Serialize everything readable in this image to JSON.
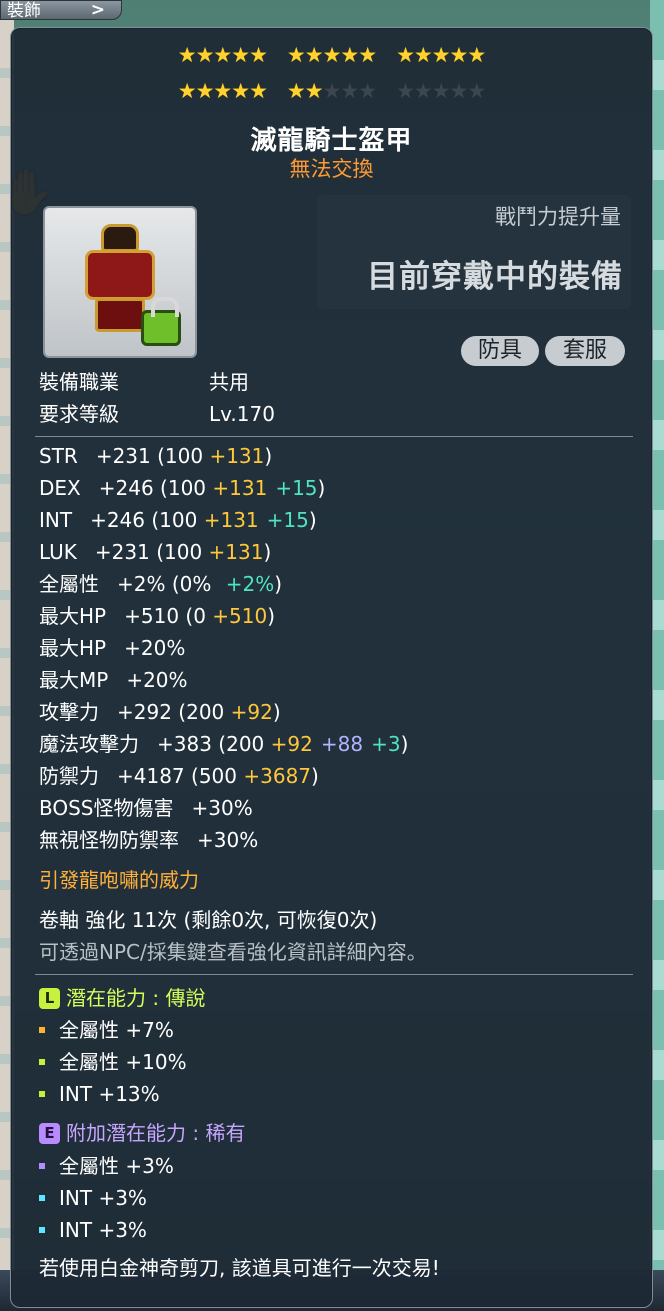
{
  "background": {
    "tab_label": "裝飾",
    "tab_chevron": ">"
  },
  "tooltip": {
    "stars": {
      "filled": 17,
      "total": 25,
      "colors": {
        "filled": "#ffd22e",
        "empty": "#3c4650"
      }
    },
    "item_name": "滅龍騎士盔甲",
    "trade_note": "無法交換",
    "combat_power_label": "戰鬥力提升量",
    "combat_power_value": "目前穿戴中的裝備",
    "tags": [
      "防具",
      "套服"
    ],
    "requirements": [
      {
        "label": "裝備職業",
        "value": "共用"
      },
      {
        "label": "要求等級",
        "value": "Lv.170"
      }
    ],
    "stats": [
      {
        "label": "STR",
        "value": "+231",
        "open": " (100 ",
        "bonus1": "+131",
        "bonus2": "",
        "bonus3": "",
        "close": ")"
      },
      {
        "label": "DEX",
        "value": "+246",
        "open": " (100 ",
        "bonus1": "+131",
        "bonus2": "",
        "bonus3": "+15",
        "close": ")"
      },
      {
        "label": "INT",
        "value": "+246",
        "open": " (100 ",
        "bonus1": "+131",
        "bonus2": "",
        "bonus3": "+15",
        "close": ")"
      },
      {
        "label": "LUK",
        "value": "+231",
        "open": " (100 ",
        "bonus1": "+131",
        "bonus2": "",
        "bonus3": "",
        "close": ")"
      },
      {
        "label": "全屬性",
        "value": "+2%",
        "open": " (0% ",
        "bonus1": "",
        "bonus2": "",
        "bonus3": "+2%",
        "close": ")"
      },
      {
        "label": "最大HP",
        "value": "+510",
        "open": " (0 ",
        "bonus1": "+510",
        "bonus2": "",
        "bonus3": "",
        "close": ")"
      },
      {
        "label": "最大HP",
        "value": "+20%",
        "open": "",
        "bonus1": "",
        "bonus2": "",
        "bonus3": "",
        "close": ""
      },
      {
        "label": "最大MP",
        "value": "+20%",
        "open": "",
        "bonus1": "",
        "bonus2": "",
        "bonus3": "",
        "close": ""
      },
      {
        "label": "攻擊力",
        "value": "+292",
        "open": " (200 ",
        "bonus1": "+92",
        "bonus2": "",
        "bonus3": "",
        "close": ")"
      },
      {
        "label": "魔法攻擊力",
        "value": "+383",
        "open": " (200 ",
        "bonus1": "+92",
        "bonus2": "+88",
        "bonus3": "+3",
        "close": ")"
      },
      {
        "label": "防禦力",
        "value": "+4187",
        "open": " (500 ",
        "bonus1": "+3687",
        "bonus2": "",
        "bonus3": "",
        "close": ")"
      },
      {
        "label": "BOSS怪物傷害",
        "value": "+30%",
        "open": "",
        "bonus1": "",
        "bonus2": "",
        "bonus3": "",
        "close": ""
      },
      {
        "label": "無視怪物防禦率",
        "value": "+30%",
        "open": "",
        "bonus1": "",
        "bonus2": "",
        "bonus3": "",
        "close": ""
      }
    ],
    "set_effect": "引發龍咆嘯的威力",
    "scroll_info": "卷軸 強化 11次 (剩餘0次, 可恢復0次)",
    "npc_hint": "可透過NPC/採集鍵查看強化資訊詳細內容。",
    "potential": {
      "badge": "L",
      "title": "潛在能力 : 傳說",
      "lines": [
        {
          "label": "全屬性",
          "value": "+7%"
        },
        {
          "label": "全屬性",
          "value": "+10%"
        },
        {
          "label": "INT",
          "value": "+13%"
        }
      ]
    },
    "additional_potential": {
      "badge": "E",
      "title": "附加潛在能力 : 稀有",
      "lines": [
        {
          "label": "全屬性",
          "value": "+3%"
        },
        {
          "label": "INT",
          "value": "+3%"
        },
        {
          "label": "INT",
          "value": "+3%"
        }
      ]
    },
    "footer_note": "若使用白金神奇剪刀, 該道具可進行一次交易!"
  }
}
